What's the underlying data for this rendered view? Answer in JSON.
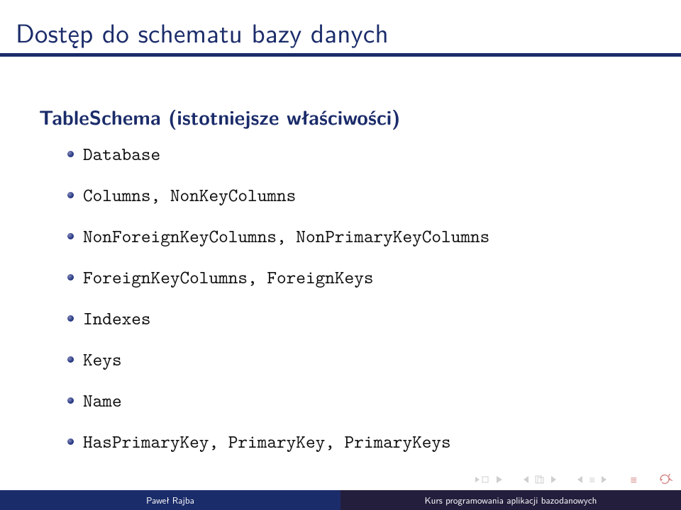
{
  "header": {
    "title": "Dostęp do schematu bazy danych"
  },
  "subtitle": "TableSchema (istotniejsze właściwości)",
  "items": [
    "Database",
    "Columns, NonKeyColumns",
    "NonForeignKeyColumns, NonPrimaryKeyColumns",
    "ForeignKeyColumns, ForeignKeys",
    "Indexes",
    "Keys",
    "Name",
    "HasPrimaryKey, PrimaryKey, PrimaryKeys"
  ],
  "footer": {
    "author": "Paweł Rajba",
    "course": "Kurs programowania aplikacji bazodanowych"
  }
}
